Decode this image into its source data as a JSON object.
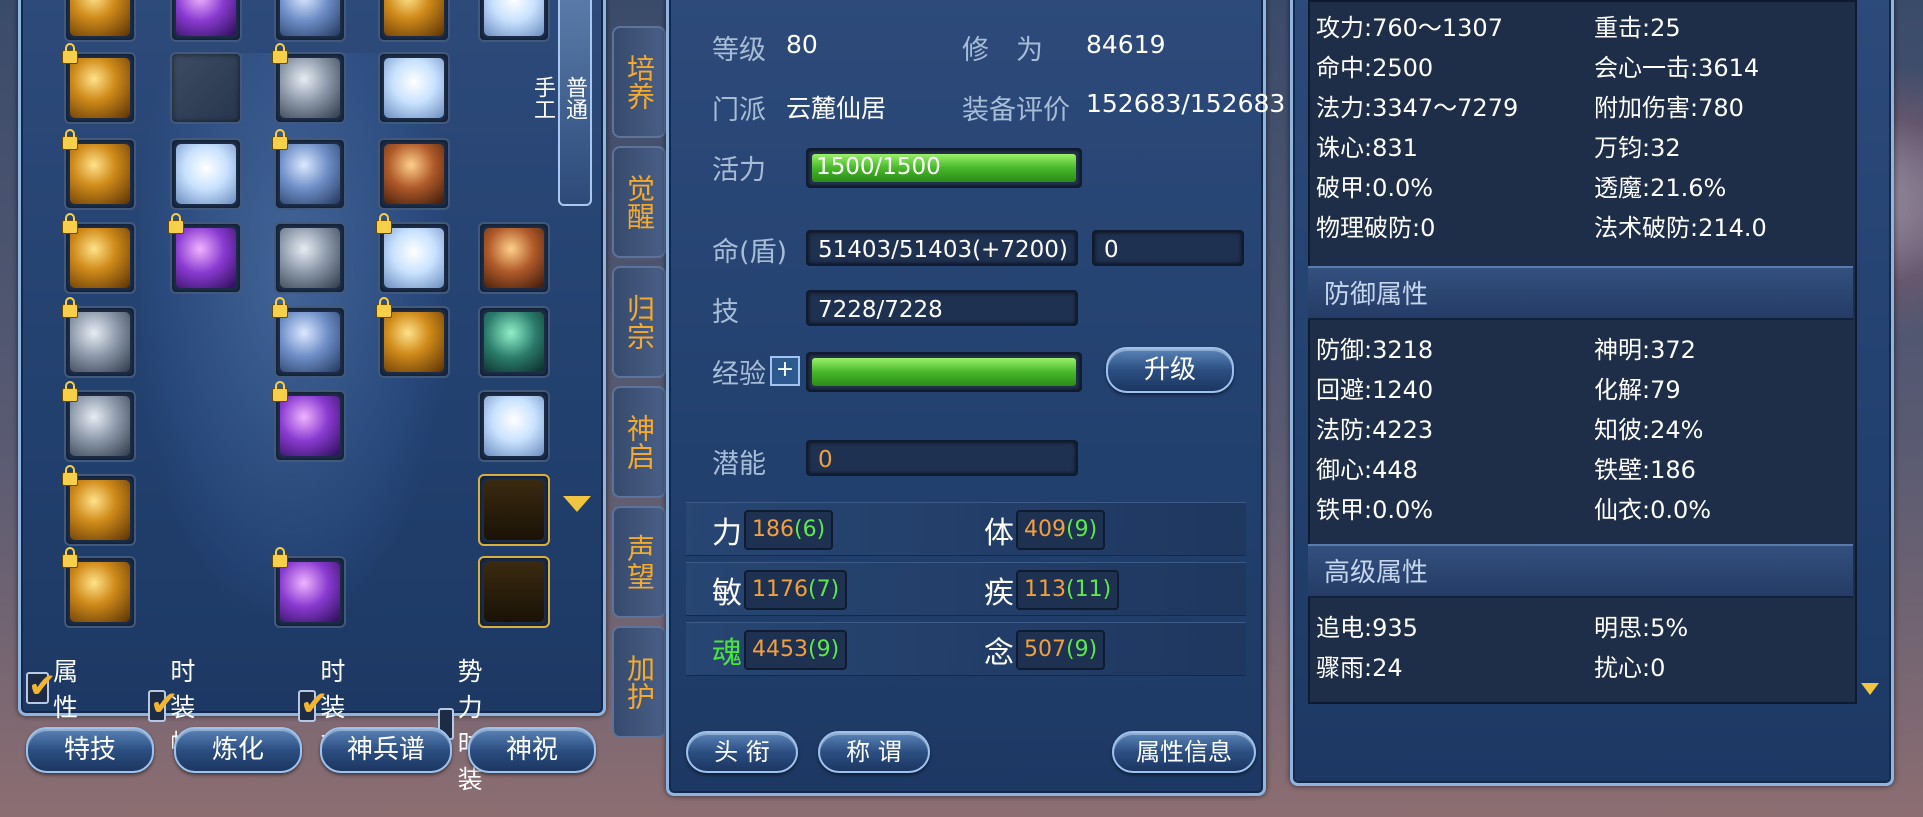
{
  "left_panel": {
    "side_tabs": [
      "普通",
      "手工"
    ],
    "checkboxes": [
      {
        "label": "属性",
        "checked": true
      },
      {
        "label": "时装帽",
        "checked": true
      },
      {
        "label": "时装衣",
        "checked": true
      },
      {
        "label": "势力时装",
        "checked": false
      }
    ],
    "buttons": [
      "特技",
      "炼化",
      "神兵谱",
      "神祝"
    ]
  },
  "vertical_tabs": [
    "培养",
    "觉醒",
    "归宗",
    "神启",
    "声望",
    "加护"
  ],
  "character": {
    "level_label": "等级",
    "level": "80",
    "cultivation_label": "修　为",
    "cultivation": "84619",
    "sect_label": "门派",
    "sect": "云麓仙居",
    "rating_label": "装备评价",
    "rating": "152683/152683",
    "vitality_label": "活力",
    "vitality": "1500/1500",
    "vitality_ratio": 1.0,
    "hp_label": "命(盾)",
    "hp": "51403/51403(+7200)",
    "shield": "0",
    "skill_label": "技",
    "skill": "7228/7228",
    "exp_label": "经验",
    "exp_ratio": 1.0,
    "upgrade_button": "升级",
    "potential_label": "潜能",
    "potential": "0",
    "stats": [
      {
        "name": "力",
        "base": "186",
        "bonus": "(6)"
      },
      {
        "name": "体",
        "base": "409",
        "bonus": "(9)"
      },
      {
        "name": "敏",
        "base": "1176",
        "bonus": "(7)"
      },
      {
        "name": "疾",
        "base": "113",
        "bonus": "(11)"
      },
      {
        "name": "魂",
        "base": "4453",
        "bonus": "(9)"
      },
      {
        "name": "念",
        "base": "507",
        "bonus": "(9)"
      }
    ],
    "bottom_buttons": [
      "头 衔",
      "称 谓",
      "属性信息"
    ]
  },
  "attributes": {
    "basic": [
      "攻力:760～1307",
      "重击:25",
      "命中:2500",
      "会心一击:3614",
      "法力:3347～7279",
      "附加伤害:780",
      "诛心:831",
      "万钧:32",
      "破甲:0.0%",
      "透魔:21.6%",
      "物理破防:0",
      "法术破防:214.0"
    ],
    "defense_header": "防御属性",
    "defense": [
      "防御:3218",
      "神明:372",
      "回避:1240",
      "化解:79",
      "法防:4223",
      "知彼:24%",
      "御心:448",
      "铁壁:186",
      "铁甲:0.0%",
      "仙衣:0.0%"
    ],
    "advanced_header": "高级属性",
    "advanced": [
      "追电:935",
      "明思:5%",
      "骤雨:24",
      "扰心:0"
    ]
  }
}
